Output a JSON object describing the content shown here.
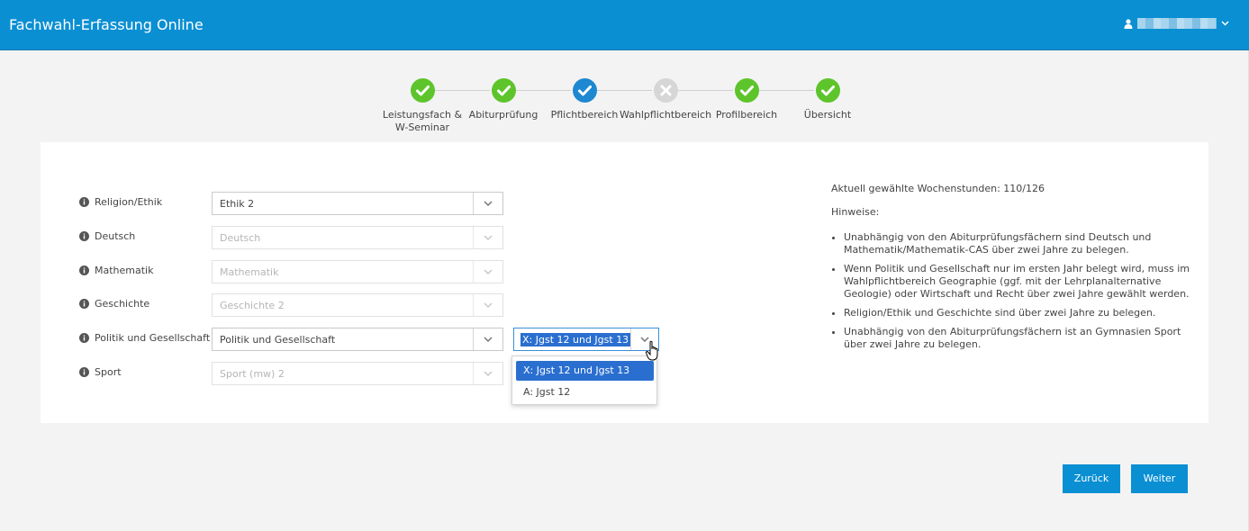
{
  "header": {
    "title": "Fachwahl-Erfassung Online"
  },
  "wizard": {
    "steps": [
      {
        "label_line1": "Leistungsfach &",
        "label_line2": "W-Seminar",
        "status": "done"
      },
      {
        "label_line1": "Abiturprüfung",
        "label_line2": "",
        "status": "done"
      },
      {
        "label_line1": "Pflichtbereich",
        "label_line2": "",
        "status": "current"
      },
      {
        "label_line1": "Wahlpflichtbereich",
        "label_line2": "",
        "status": "error"
      },
      {
        "label_line1": "Profilbereich",
        "label_line2": "",
        "status": "done"
      },
      {
        "label_line1": "Übersicht",
        "label_line2": "",
        "status": "done"
      }
    ]
  },
  "form": {
    "rows": [
      {
        "label": "Religion/Ethik",
        "value": "Ethik 2",
        "disabled": false
      },
      {
        "label": "Deutsch",
        "value": "Deutsch",
        "disabled": true
      },
      {
        "label": "Mathematik",
        "value": "Mathematik",
        "disabled": true
      },
      {
        "label": "Geschichte",
        "value": "Geschichte 2",
        "disabled": true
      },
      {
        "label": "Politik und Gesellschaft",
        "value": "Politik und Gesellschaft",
        "disabled": false
      },
      {
        "label": "Sport",
        "value": "Sport (mw) 2",
        "disabled": true
      }
    ],
    "jgst_select": {
      "value": "X: Jgst 12 und Jgst 13",
      "options": [
        "X: Jgst 12 und Jgst 13",
        "A: Jgst 12"
      ]
    }
  },
  "info": {
    "hours": "Aktuell gewählte Wochenstunden: 110/126",
    "hints_title": "Hinweise:",
    "hints": [
      "Unabhängig von den Abiturprüfungsfächern sind Deutsch und Mathematik/Mathematik-CAS über zwei Jahre zu belegen.",
      "Wenn Politik und Gesellschaft nur im ersten Jahr belegt wird, muss im Wahlpflichtbereich Geographie (ggf. mit der Lehrplanalternative Geologie) oder Wirtschaft und Recht über zwei Jahre gewählt werden.",
      "Religion/Ethik und Geschichte sind über zwei Jahre zu belegen.",
      "Unabhängig von den Abiturprüfungsfächern ist an Gymnasien Sport über zwei Jahre zu belegen."
    ]
  },
  "buttons": {
    "back": "Zurück",
    "next": "Weiter"
  },
  "colors": {
    "header": "#0a8fd3",
    "done": "#5ec42b",
    "current": "#1e88d0",
    "error": "#d6d6d6",
    "button": "#0a8fd3"
  }
}
